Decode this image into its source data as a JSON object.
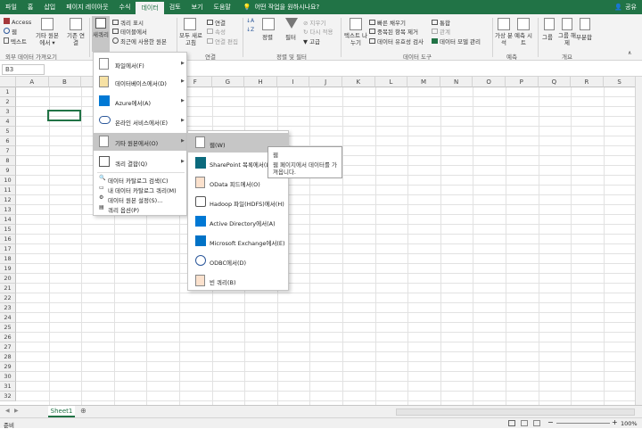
{
  "ribbon_tabs": [
    "파일",
    "홈",
    "삽입",
    "페이지 레이아웃",
    "수식",
    "데이터",
    "검토",
    "보기",
    "도움말"
  ],
  "active_tab": "데이터",
  "tell_me": "어떤 작업을 원하시나요?",
  "share": "공유",
  "ribbon": {
    "access": "Access",
    "web": "웹",
    "text": "텍스트",
    "other_sources": "기타 원본에서 ▾",
    "existing_connections": "기존 연결",
    "new_query": "새쿼리",
    "show_queries": "쿼리 표시",
    "from_table": "테이블에서",
    "recent_sources": "최근에 사용한 원본",
    "refresh_all": "모두 새로 고침",
    "connections": "연결",
    "properties": "속성",
    "edit_links": "연결 편집",
    "sort": "정렬",
    "filter": "필터",
    "clear": "지우기",
    "reapply": "다시 적용",
    "advanced": "고급",
    "text_to_columns": "텍스트 나누기",
    "flash_fill": "빠른 채우기",
    "remove_duplicates": "중복된 항목 제거",
    "data_validation": "데이터 유효성 검사",
    "consolidate": "통합",
    "relationships": "관계",
    "manage_data_model": "데이터 모델 관리",
    "what_if": "가상 분석",
    "forecast_sheet": "예측 시트",
    "group": "그룹",
    "ungroup": "그룹 해제",
    "subtotal": "부분합",
    "groups": {
      "external": "외부 데이터 가져오기",
      "connections": "연결",
      "sort_filter": "정렬 및 필터",
      "data_tools": "데이터 도구",
      "forecast": "예측",
      "outline": "개요"
    }
  },
  "name_box": "B3",
  "columns": [
    "A",
    "B",
    "C",
    "D",
    "E",
    "F",
    "G",
    "H",
    "I",
    "J",
    "K",
    "L",
    "M",
    "N",
    "O",
    "P",
    "Q",
    "R",
    "S"
  ],
  "rows": [
    "1",
    "2",
    "3",
    "4",
    "5",
    "6",
    "7",
    "8",
    "9",
    "10",
    "11",
    "12",
    "13",
    "14",
    "15",
    "16",
    "17",
    "18",
    "19",
    "20",
    "21",
    "22",
    "23",
    "24",
    "25",
    "26",
    "27",
    "28",
    "29",
    "30",
    "31",
    "32"
  ],
  "menu1": [
    {
      "label": "파일에서(F)",
      "arrow": true
    },
    {
      "label": "데이터베이스에서(D)",
      "arrow": true
    },
    {
      "label": "Azure에서(A)",
      "arrow": true
    },
    {
      "label": "온라인 서비스에서(E)",
      "arrow": true
    },
    {
      "label": "기타 원본에서(O)",
      "arrow": true
    },
    {
      "label": "쿼리 결합(Q)",
      "arrow": true
    }
  ],
  "menu1_small": [
    "데이터 카탈로그 검색(C)",
    "내 데이터 카탈로그 쿼리(M)",
    "데이터 원본 설정(S)...",
    "쿼리 옵션(P)"
  ],
  "menu2": [
    "웹(W)",
    "SharePoint 목록에서(L)",
    "OData 피드에서(O)",
    "Hadoop 파일(HDFS)에서(H)",
    "Active Directory에서(A)",
    "Microsoft Exchange에서(E)",
    "ODBC에서(D)",
    "빈 쿼리(B)"
  ],
  "tooltip": {
    "title": "웹",
    "body": "웹 페이지에서 데이터를 가져옵니다."
  },
  "sheet_tab": "Sheet1",
  "status": "준비",
  "zoom": "100%",
  "colors": {
    "accent": "#217346",
    "highlight": "#c6c6c6"
  }
}
